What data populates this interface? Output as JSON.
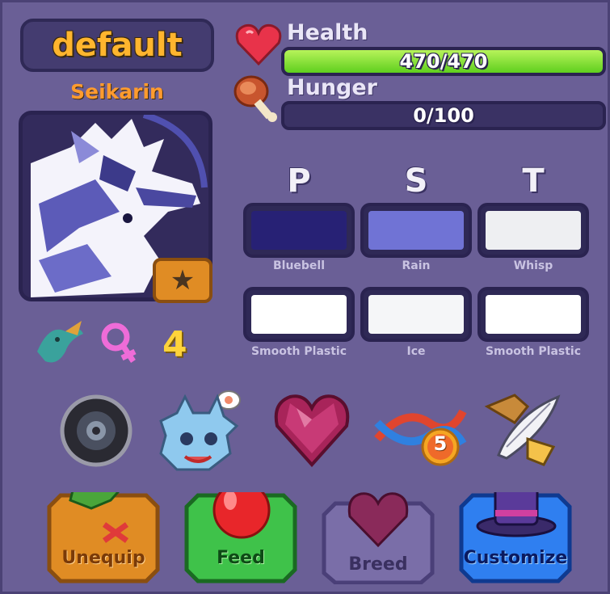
{
  "profile": {
    "name": "default",
    "species": "Seikarin",
    "level": "4",
    "gender_icon": "female-symbol-icon"
  },
  "stats": {
    "health": {
      "label": "Health",
      "text": "470/470",
      "fraction": 1.0,
      "color": "#7be033"
    },
    "hunger": {
      "label": "Hunger",
      "text": "0/100",
      "fraction": 0.0,
      "color": "#7be033"
    }
  },
  "colors": {
    "headers": [
      "P",
      "S",
      "T"
    ],
    "slots": [
      {
        "name": "Bluebell",
        "hex": "#272175"
      },
      {
        "name": "Rain",
        "hex": "#7073d5"
      },
      {
        "name": "Whisp",
        "hex": "#eeeff2"
      },
      {
        "name": "Smooth Plastic",
        "hex": "#ffffff"
      },
      {
        "name": "Ice",
        "hex": "#f5f6f8"
      },
      {
        "name": "Smooth Plastic",
        "hex": "#ffffff"
      }
    ]
  },
  "actions": {
    "dna_count": "5",
    "icons": [
      "ring-accessory-icon",
      "hungry-pet-icon",
      "heart-gem-icon",
      "dna-icon",
      "feather-quill-icon"
    ]
  },
  "buttons": {
    "unequip": "Unequip",
    "feed": "Feed",
    "breed": "Breed",
    "customize": "Customize"
  },
  "theme": {
    "panel": "#6a5f96",
    "unequip": "#e08c24",
    "feed": "#3fc24a",
    "breed": "#7a6ea8",
    "customize": "#2f7ff0"
  }
}
